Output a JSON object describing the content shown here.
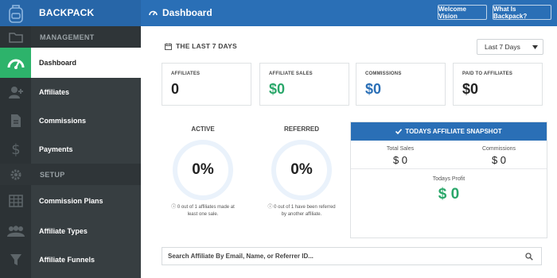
{
  "app": {
    "brand": "BACKPACK"
  },
  "header": {
    "page_title": "Dashboard",
    "welcome_label": "Welcome Vision",
    "what_label": "What Is Backpack?"
  },
  "sidebar": {
    "sections": [
      {
        "label": "MANAGEMENT"
      },
      {
        "label": "SETUP"
      }
    ],
    "items": [
      {
        "label": "Dashboard",
        "active": true,
        "icon": "speedometer-icon"
      },
      {
        "label": "Affiliates",
        "active": false,
        "icon": "add-user-icon"
      },
      {
        "label": "Commissions",
        "active": false,
        "icon": "document-icon"
      },
      {
        "label": "Payments",
        "active": false,
        "icon": "dollar-icon"
      },
      {
        "label": "Commission Plans",
        "active": false,
        "icon": "table-icon"
      },
      {
        "label": "Affiliate Types",
        "active": false,
        "icon": "users-icon"
      },
      {
        "label": "Affiliate Funnels",
        "active": false,
        "icon": "funnel-icon"
      }
    ],
    "setup_icon": "gear-icon"
  },
  "period": {
    "title": "THE LAST 7 DAYS",
    "select_value": "Last 7 Days"
  },
  "stats": [
    {
      "label": "AFFILIATES",
      "value": "0"
    },
    {
      "label": "AFFILIATE SALES",
      "value": "$0"
    },
    {
      "label": "COMMISSIONS",
      "value": "$0"
    },
    {
      "label": "PAID TO AFFILIATES",
      "value": "$0"
    }
  ],
  "rings": [
    {
      "label": "ACTIVE",
      "percent": "0%",
      "note": "0 out of 1 affiliates made at least one sale."
    },
    {
      "label": "REFERRED",
      "percent": "0%",
      "note": "0 out of 1 have been referred by another affiliate."
    }
  ],
  "snapshot": {
    "title": "TODAYS AFFILIATE SNAPSHOT",
    "total_sales_label": "Total Sales",
    "total_sales_value": "$ 0",
    "commissions_label": "Commissions",
    "commissions_value": "$ 0",
    "profit_label": "Todays Profit",
    "profit_value": "$ 0"
  },
  "search": {
    "placeholder": "Search Affiliate By Email, Name, or Referrer ID..."
  },
  "colors": {
    "brand_blue": "#2a6fb6",
    "sidebar": "#373e41",
    "active_green": "#2db36b",
    "money_green": "#2aa76a"
  }
}
